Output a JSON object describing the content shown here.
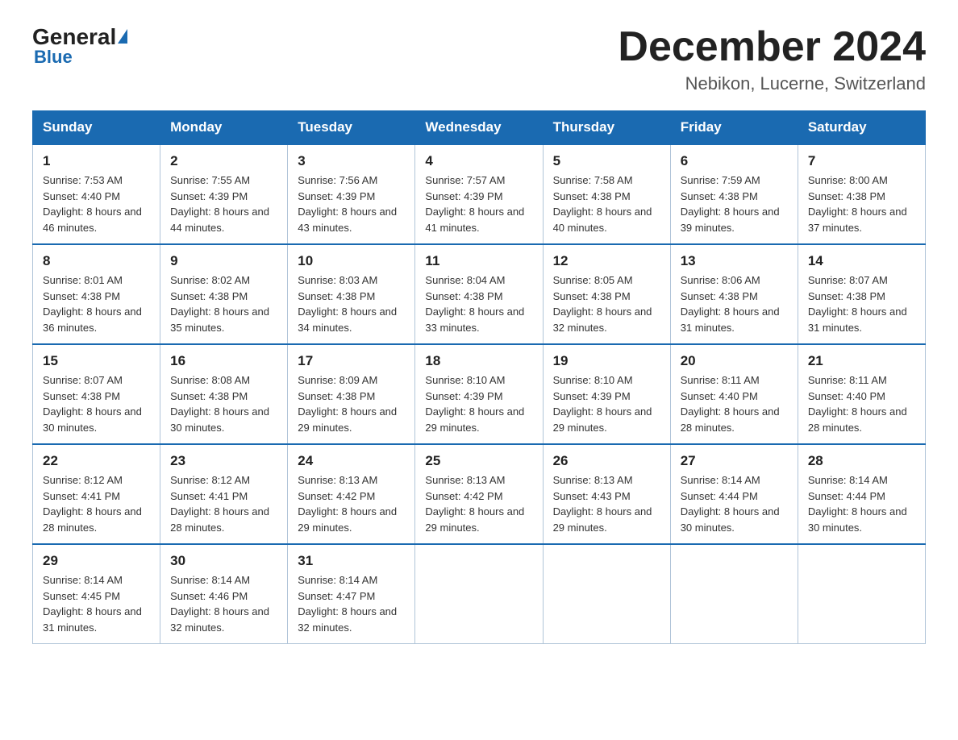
{
  "header": {
    "logo": {
      "general": "General",
      "blue": "Blue",
      "subtitle": "Blue"
    },
    "title": "December 2024",
    "location": "Nebikon, Lucerne, Switzerland"
  },
  "calendar": {
    "days_of_week": [
      "Sunday",
      "Monday",
      "Tuesday",
      "Wednesday",
      "Thursday",
      "Friday",
      "Saturday"
    ],
    "weeks": [
      [
        {
          "day": "1",
          "sunrise": "7:53 AM",
          "sunset": "4:40 PM",
          "daylight": "8 hours and 46 minutes."
        },
        {
          "day": "2",
          "sunrise": "7:55 AM",
          "sunset": "4:39 PM",
          "daylight": "8 hours and 44 minutes."
        },
        {
          "day": "3",
          "sunrise": "7:56 AM",
          "sunset": "4:39 PM",
          "daylight": "8 hours and 43 minutes."
        },
        {
          "day": "4",
          "sunrise": "7:57 AM",
          "sunset": "4:39 PM",
          "daylight": "8 hours and 41 minutes."
        },
        {
          "day": "5",
          "sunrise": "7:58 AM",
          "sunset": "4:38 PM",
          "daylight": "8 hours and 40 minutes."
        },
        {
          "day": "6",
          "sunrise": "7:59 AM",
          "sunset": "4:38 PM",
          "daylight": "8 hours and 39 minutes."
        },
        {
          "day": "7",
          "sunrise": "8:00 AM",
          "sunset": "4:38 PM",
          "daylight": "8 hours and 37 minutes."
        }
      ],
      [
        {
          "day": "8",
          "sunrise": "8:01 AM",
          "sunset": "4:38 PM",
          "daylight": "8 hours and 36 minutes."
        },
        {
          "day": "9",
          "sunrise": "8:02 AM",
          "sunset": "4:38 PM",
          "daylight": "8 hours and 35 minutes."
        },
        {
          "day": "10",
          "sunrise": "8:03 AM",
          "sunset": "4:38 PM",
          "daylight": "8 hours and 34 minutes."
        },
        {
          "day": "11",
          "sunrise": "8:04 AM",
          "sunset": "4:38 PM",
          "daylight": "8 hours and 33 minutes."
        },
        {
          "day": "12",
          "sunrise": "8:05 AM",
          "sunset": "4:38 PM",
          "daylight": "8 hours and 32 minutes."
        },
        {
          "day": "13",
          "sunrise": "8:06 AM",
          "sunset": "4:38 PM",
          "daylight": "8 hours and 31 minutes."
        },
        {
          "day": "14",
          "sunrise": "8:07 AM",
          "sunset": "4:38 PM",
          "daylight": "8 hours and 31 minutes."
        }
      ],
      [
        {
          "day": "15",
          "sunrise": "8:07 AM",
          "sunset": "4:38 PM",
          "daylight": "8 hours and 30 minutes."
        },
        {
          "day": "16",
          "sunrise": "8:08 AM",
          "sunset": "4:38 PM",
          "daylight": "8 hours and 30 minutes."
        },
        {
          "day": "17",
          "sunrise": "8:09 AM",
          "sunset": "4:38 PM",
          "daylight": "8 hours and 29 minutes."
        },
        {
          "day": "18",
          "sunrise": "8:10 AM",
          "sunset": "4:39 PM",
          "daylight": "8 hours and 29 minutes."
        },
        {
          "day": "19",
          "sunrise": "8:10 AM",
          "sunset": "4:39 PM",
          "daylight": "8 hours and 29 minutes."
        },
        {
          "day": "20",
          "sunrise": "8:11 AM",
          "sunset": "4:40 PM",
          "daylight": "8 hours and 28 minutes."
        },
        {
          "day": "21",
          "sunrise": "8:11 AM",
          "sunset": "4:40 PM",
          "daylight": "8 hours and 28 minutes."
        }
      ],
      [
        {
          "day": "22",
          "sunrise": "8:12 AM",
          "sunset": "4:41 PM",
          "daylight": "8 hours and 28 minutes."
        },
        {
          "day": "23",
          "sunrise": "8:12 AM",
          "sunset": "4:41 PM",
          "daylight": "8 hours and 28 minutes."
        },
        {
          "day": "24",
          "sunrise": "8:13 AM",
          "sunset": "4:42 PM",
          "daylight": "8 hours and 29 minutes."
        },
        {
          "day": "25",
          "sunrise": "8:13 AM",
          "sunset": "4:42 PM",
          "daylight": "8 hours and 29 minutes."
        },
        {
          "day": "26",
          "sunrise": "8:13 AM",
          "sunset": "4:43 PM",
          "daylight": "8 hours and 29 minutes."
        },
        {
          "day": "27",
          "sunrise": "8:14 AM",
          "sunset": "4:44 PM",
          "daylight": "8 hours and 30 minutes."
        },
        {
          "day": "28",
          "sunrise": "8:14 AM",
          "sunset": "4:44 PM",
          "daylight": "8 hours and 30 minutes."
        }
      ],
      [
        {
          "day": "29",
          "sunrise": "8:14 AM",
          "sunset": "4:45 PM",
          "daylight": "8 hours and 31 minutes."
        },
        {
          "day": "30",
          "sunrise": "8:14 AM",
          "sunset": "4:46 PM",
          "daylight": "8 hours and 32 minutes."
        },
        {
          "day": "31",
          "sunrise": "8:14 AM",
          "sunset": "4:47 PM",
          "daylight": "8 hours and 32 minutes."
        },
        null,
        null,
        null,
        null
      ]
    ]
  }
}
